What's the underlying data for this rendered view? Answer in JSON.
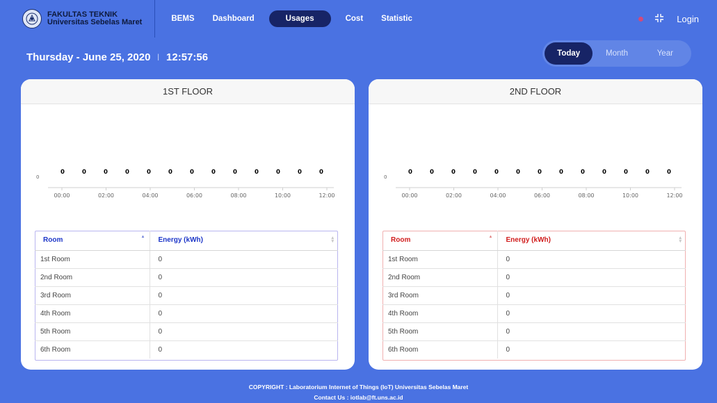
{
  "brand": {
    "line1": "FAKULTAS TEKNIK",
    "line2": "Universitas Sebelas Maret"
  },
  "nav": {
    "bems": "BEMS",
    "dashboard": "Dashboard",
    "usages": "Usages",
    "cost": "Cost",
    "statistic": "Statistic",
    "login": "Login"
  },
  "date": {
    "day": "Thursday - June 25, 2020",
    "separator": "|",
    "time": "12:57:56"
  },
  "period": {
    "today": "Today",
    "month": "Month",
    "year": "Year",
    "selected": "Today"
  },
  "floors": [
    {
      "title": "1ST FLOOR",
      "accent": "#1c35c8",
      "table_headers": {
        "room": "Room",
        "energy": "Energy (kWh)"
      },
      "rows": [
        {
          "room": "1st Room",
          "energy": "0"
        },
        {
          "room": "2nd Room",
          "energy": "0"
        },
        {
          "room": "3rd Room",
          "energy": "0"
        },
        {
          "room": "4th Room",
          "energy": "0"
        },
        {
          "room": "5th Room",
          "energy": "0"
        },
        {
          "room": "6th Room",
          "energy": "0"
        }
      ]
    },
    {
      "title": "2ND FLOOR",
      "accent": "#d11c1c",
      "table_headers": {
        "room": "Room",
        "energy": "Energy (kWh)"
      },
      "rows": [
        {
          "room": "1st Room",
          "energy": "0"
        },
        {
          "room": "2nd Room",
          "energy": "0"
        },
        {
          "room": "3rd Room",
          "energy": "0"
        },
        {
          "room": "4th Room",
          "energy": "0"
        },
        {
          "room": "5th Room",
          "energy": "0"
        },
        {
          "room": "6th Room",
          "energy": "0"
        }
      ]
    }
  ],
  "chart_data": [
    {
      "type": "line",
      "x": [
        "00:00",
        "01:00",
        "02:00",
        "03:00",
        "04:00",
        "05:00",
        "06:00",
        "07:00",
        "08:00",
        "09:00",
        "10:00",
        "11:00",
        "12:00"
      ],
      "xticks": [
        "00:00",
        "02:00",
        "04:00",
        "06:00",
        "08:00",
        "10:00",
        "12:00"
      ],
      "values": [
        0,
        0,
        0,
        0,
        0,
        0,
        0,
        0,
        0,
        0,
        0,
        0,
        0
      ],
      "ytick": "0",
      "data_labels": true
    },
    {
      "type": "line",
      "x": [
        "00:00",
        "01:00",
        "02:00",
        "03:00",
        "04:00",
        "05:00",
        "06:00",
        "07:00",
        "08:00",
        "09:00",
        "10:00",
        "11:00",
        "12:00"
      ],
      "xticks": [
        "00:00",
        "02:00",
        "04:00",
        "06:00",
        "08:00",
        "10:00",
        "12:00"
      ],
      "values": [
        0,
        0,
        0,
        0,
        0,
        0,
        0,
        0,
        0,
        0,
        0,
        0,
        0
      ],
      "ytick": "0",
      "data_labels": true
    }
  ],
  "footer": {
    "copyright": "COPYRIGHT : Laboratorium Internet of Things (IoT) Universitas Sebelas Maret",
    "contact": "Contact Us : iotlab@ft.uns.ac.id"
  }
}
